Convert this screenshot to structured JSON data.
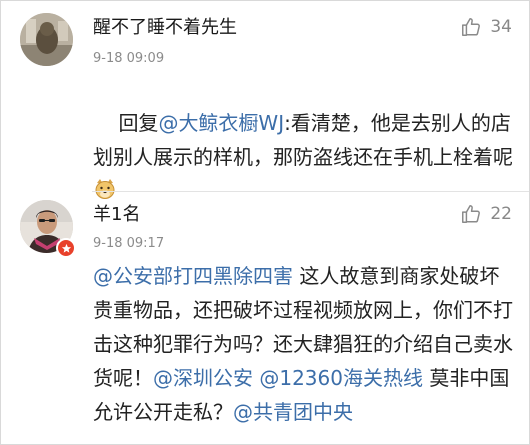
{
  "comments": [
    {
      "username": "醒不了睡不着先生",
      "time": "9-18 09:09",
      "likes": "34",
      "body": [
        {
          "text": "回复",
          "mention": false
        },
        {
          "text": "@大鲸衣橱WJ",
          "mention": true
        },
        {
          "text": ":看清楚，他是去别人的店划别人展示的样机，那防盗线还在手机上栓着呢",
          "mention": false
        }
      ],
      "emoji": "doge-emoji"
    },
    {
      "username": "羊1名",
      "time": "9-18 09:17",
      "likes": "22",
      "body": [
        {
          "text": "@公安部打四黑除四害",
          "mention": true
        },
        {
          "text": " 这人故意到商家处破坏贵重物品，还把破坏过程视频放网上，你们不打击这种犯罪行为吗？还大肆猖狂的介绍自己卖水货呢！",
          "mention": false
        },
        {
          "text": "@深圳公安",
          "mention": true
        },
        {
          "text": " ",
          "mention": false
        },
        {
          "text": "@12360海关热线",
          "mention": true
        },
        {
          "text": " 莫非中国允许公开走私？",
          "mention": false
        },
        {
          "text": "@共青团中央",
          "mention": true
        }
      ]
    }
  ],
  "colors": {
    "mention": "#3c6ea9",
    "time": "#8b8b8b",
    "like": "#888888",
    "badge": "#e8412b"
  },
  "icons": {
    "like": "thumbs-up-icon",
    "badge": "vip-badge-icon"
  }
}
